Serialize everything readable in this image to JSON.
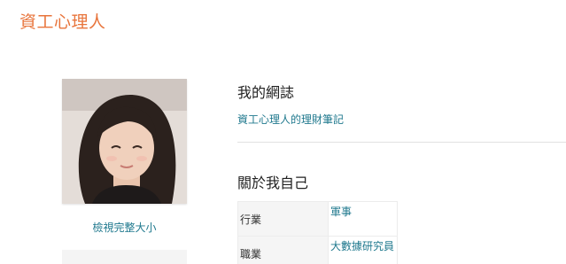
{
  "header": {
    "blog_title": "資工心理人"
  },
  "sidebar": {
    "avatar_alt": "profile photo",
    "view_full_size_label": "檢視完整大小"
  },
  "blogs": {
    "heading": "我的網誌",
    "items": [
      {
        "label": "資工心理人的理財筆記"
      }
    ]
  },
  "about": {
    "heading": "關於我自己",
    "rows": [
      {
        "key": "行業",
        "value": "軍事"
      },
      {
        "key": "職業",
        "value": "大數據研究員"
      }
    ]
  },
  "colors": {
    "title": "#e8743b",
    "link": "#20798e",
    "text": "#212121"
  }
}
